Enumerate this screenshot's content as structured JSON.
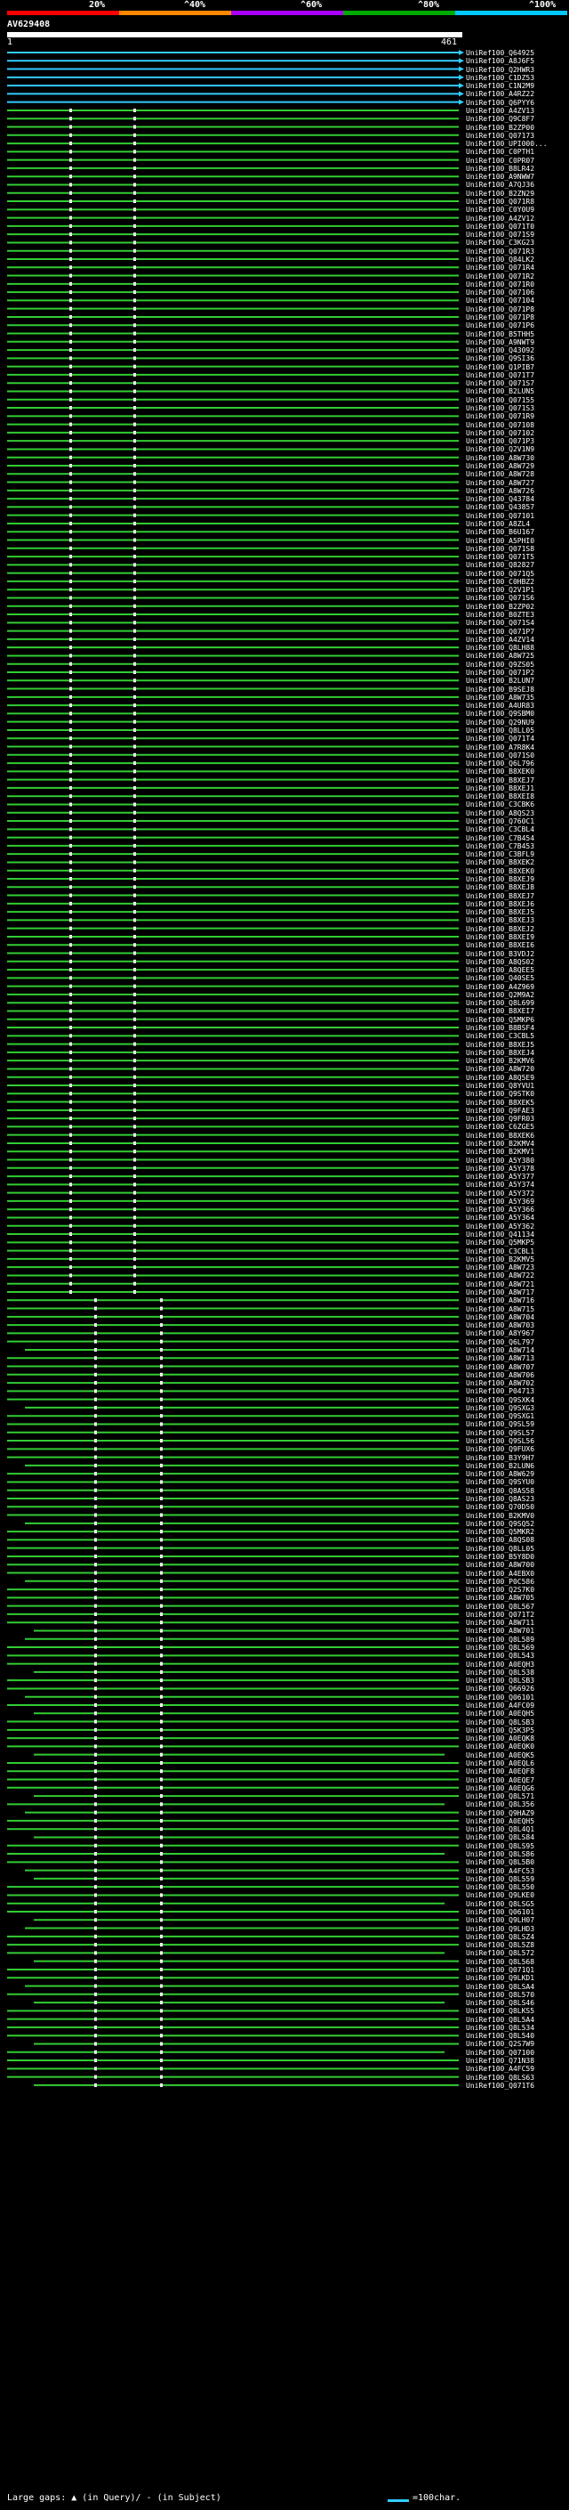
{
  "scale": {
    "ticks": [
      {
        "label": "20%"
      },
      {
        "label": "^40%"
      },
      {
        "label": "^60%"
      },
      {
        "label": "^80%"
      },
      {
        "label": "^100%"
      }
    ],
    "colors": [
      "#ff0000",
      "#ff8800",
      "#aa00ff",
      "#00aa00",
      "#00c8ff"
    ]
  },
  "query": {
    "id": "AV629408",
    "start": "1",
    "end": "461"
  },
  "legend": {
    "gaps": "Large gaps: ▲ (in Query)/ - (in Subject)",
    "scale": "=100char."
  },
  "colors": {
    "cyan_hit": "#33ccff",
    "green_hit": "#33cc33",
    "gap_marker": "#ffffff"
  },
  "hits": [
    "UniRef100_Q64925",
    "UniRef100_A8J6F5",
    "UniRef100_Q2HWR3",
    "UniRef100_C1DZ53",
    "UniRef100_C1N2M9",
    "UniRef100_A4RZ22",
    "UniRef100_Q6PYY6",
    "UniRef100_A4ZV13",
    "UniRef100_Q9C8F7",
    "UniRef100_B2ZP00",
    "UniRef100_Q07173",
    "UniRef100_UPI000...",
    "UniRef100_C0PTH1",
    "UniRef100_C0PR07",
    "UniRef100_B8LR42",
    "UniRef100_A9NWW7",
    "UniRef100_A7QJ36",
    "UniRef100_B2ZN29",
    "UniRef100_Q071R8",
    "UniRef100_C0Y0U9",
    "UniRef100_A4ZV12",
    "UniRef100_Q071T0",
    "UniRef100_Q071S9",
    "UniRef100_C3KG23",
    "UniRef100_Q071R3",
    "UniRef100_Q84LK2",
    "UniRef100_Q071R4",
    "UniRef100_Q071R2",
    "UniRef100_Q071R0",
    "UniRef100_Q07106",
    "UniRef100_Q07104",
    "UniRef100_Q071P8",
    "UniRef100_Q071P8",
    "UniRef100_Q071P6",
    "UniRef100_B5THH5",
    "UniRef100_A9NWT9",
    "UniRef100_Q43092",
    "UniRef100_Q9SI36",
    "UniRef100_Q1PIB7",
    "UniRef100_Q071T7",
    "UniRef100_Q071S7",
    "UniRef100_B2LUN5",
    "UniRef100_Q07155",
    "UniRef100_Q071S3",
    "UniRef100_Q071R9",
    "UniRef100_Q07108",
    "UniRef100_Q07102",
    "UniRef100_Q071P3",
    "UniRef100_Q2V1N9",
    "UniRef100_A8W730",
    "UniRef100_A8W729",
    "UniRef100_A8W728",
    "UniRef100_A8W727",
    "UniRef100_A8W726",
    "UniRef100_Q43784",
    "UniRef100_Q43857",
    "UniRef100_Q07101",
    "UniRef100_A8ZL4",
    "UniRef100_B6U167",
    "UniRef100_A5PHI0",
    "UniRef100_Q071S8",
    "UniRef100_Q071T5",
    "UniRef100_Q82827",
    "UniRef100_Q071Q5",
    "UniRef100_C0HBZ2",
    "UniRef100_Q2V1P1",
    "UniRef100_Q071S6",
    "UniRef100_B2ZP02",
    "UniRef100_B0ZTE3",
    "UniRef100_Q071S4",
    "UniRef100_Q071P7",
    "UniRef100_A4ZV14",
    "UniRef100_Q8LH88",
    "UniRef100_A8W725",
    "UniRef100_Q9ZS05",
    "UniRef100_Q071P2",
    "UniRef100_B2LUN7",
    "UniRef100_B9SEJ8",
    "UniRef100_A8W735",
    "UniRef100_A4UR83",
    "UniRef100_Q9SBM0",
    "UniRef100_Q29NU9",
    "UniRef100_Q8LL05",
    "UniRef100_Q071T4",
    "UniRef100_A7R8K4",
    "UniRef100_Q071S0",
    "UniRef100_Q6L796",
    "UniRef100_B8XEK0",
    "UniRef100_B8XEJ7",
    "UniRef100_B8XEJ1",
    "UniRef100_B8XEI8",
    "UniRef100_C3CBK6",
    "UniRef100_A8QS23",
    "UniRef100_Q760C1",
    "UniRef100_C3CBL4",
    "UniRef100_C7B454",
    "UniRef100_C7B453",
    "UniRef100_C3BFL9",
    "UniRef100_B8XEK2",
    "UniRef100_B8XEK0",
    "UniRef100_B8XEJ9",
    "UniRef100_B8XEJ8",
    "UniRef100_B8XEJ7",
    "UniRef100_B8XEJ6",
    "UniRef100_B8XEJ5",
    "UniRef100_B8XEJ3",
    "UniRef100_B8XEJ2",
    "UniRef100_B8XEI9",
    "UniRef100_B8XEI6",
    "UniRef100_B3VDJ2",
    "UniRef100_A8QS02",
    "UniRef100_A8QEE5",
    "UniRef100_Q40SE5",
    "UniRef100_A4Z969",
    "UniRef100_Q2M9A2",
    "UniRef100_Q8L699",
    "UniRef100_B8XEI7",
    "UniRef100_Q5MKP6",
    "UniRef100_B8BSF4",
    "UniRef100_C3CBL5",
    "UniRef100_B8XEJ5",
    "UniRef100_B8XEJ4",
    "UniRef100_B2KMV6",
    "UniRef100_A8W720",
    "UniRef100_A8Q5E9",
    "UniRef100_Q8YVU1",
    "UniRef100_Q9STK0",
    "UniRef100_B8XEK5",
    "UniRef100_Q9FAE3",
    "UniRef100_Q9FR03",
    "UniRef100_C6ZGE5",
    "UniRef100_B8XEK6",
    "UniRef100_B2KMV4",
    "UniRef100_B2KMV1",
    "UniRef100_A5Y380",
    "UniRef100_A5Y378",
    "UniRef100_A5Y377",
    "UniRef100_A5Y374",
    "UniRef100_A5Y372",
    "UniRef100_A5Y369",
    "UniRef100_A5Y366",
    "UniRef100_A5Y364",
    "UniRef100_A5Y362",
    "UniRef100_Q41134",
    "UniRef100_Q5MKP5",
    "UniRef100_C3CBL1",
    "UniRef100_B2KMV5",
    "UniRef100_A8W723",
    "UniRef100_A8W722",
    "UniRef100_A8W721",
    "UniRef100_A8W717",
    "UniRef100_A8W716",
    "UniRef100_A8W715",
    "UniRef100_A8W704",
    "UniRef100_A8W703",
    "UniRef100_A8Y967",
    "UniRef100_Q6L797",
    "UniRef100_A8W714",
    "UniRef100_A8W713",
    "UniRef100_A8W707",
    "UniRef100_A8W706",
    "UniRef100_A8W702",
    "UniRef100_P04713",
    "UniRef100_Q9SXK4",
    "UniRef100_Q9SXG3",
    "UniRef100_Q9SXG1",
    "UniRef100_Q9SL59",
    "UniRef100_Q9SL57",
    "UniRef100_Q9SL56",
    "UniRef100_Q9FUX6",
    "UniRef100_B3Y9H7",
    "UniRef100_B2LUN6",
    "UniRef100_A8W629",
    "UniRef100_Q9SYU0",
    "UniRef100_Q8AS58",
    "UniRef100_Q8AS23",
    "UniRef100_Q70D50",
    "UniRef100_B2KMV0",
    "UniRef100_Q9SQ52",
    "UniRef100_Q5MKR2",
    "UniRef100_A8QS08",
    "UniRef100_Q8LL05",
    "UniRef100_B5Y8D0",
    "UniRef100_A8W700",
    "UniRef100_A4EBX0",
    "UniRef100_P0C586",
    "UniRef100_Q2S7K0",
    "UniRef100_A8W705",
    "UniRef100_Q8L567",
    "UniRef100_Q071T2",
    "UniRef100_A8W711",
    "UniRef100_A8W701",
    "UniRef100_Q8L589",
    "UniRef100_Q8L569",
    "UniRef100_Q8L543",
    "UniRef100_A0EQH3",
    "UniRef100_Q8L538",
    "UniRef100_Q8LSB3",
    "UniRef100_Q66926",
    "UniRef100_Q06101",
    "UniRef100_A4FC09",
    "UniRef100_A0EQH5",
    "UniRef100_Q8LSB3",
    "UniRef100_Q5K3P5",
    "UniRef100_A0EQK8",
    "UniRef100_A0EQK0",
    "UniRef100_A0EQK5",
    "UniRef100_A0EQL6",
    "UniRef100_A0EQF8",
    "UniRef100_A0EQE7",
    "UniRef100_A0EQG6",
    "UniRef100_Q8L571",
    "UniRef100_Q8L356",
    "UniRef100_Q9HAZ9",
    "UniRef100_A0EQH5",
    "UniRef100_Q8L4Q1",
    "UniRef100_Q8LS84",
    "UniRef100_Q8LS95",
    "UniRef100_Q8LS86",
    "UniRef100_Q8L5B0",
    "UniRef100_A4FC53",
    "UniRef100_Q8L559",
    "UniRef100_Q8L550",
    "UniRef100_Q9LKE0",
    "UniRef100_Q8LSG5",
    "UniRef100_Q06101",
    "UniRef100_Q9LH07",
    "UniRef100_Q9LHD3",
    "UniRef100_Q8LSZ4",
    "UniRef100_Q8L5Z8",
    "UniRef100_Q8L572",
    "UniRef100_Q8L568",
    "UniRef100_Q071Q1",
    "UniRef100_Q9LKD1",
    "UniRef100_Q8LSA4",
    "UniRef100_Q8L570",
    "UniRef100_Q8LS46",
    "UniRef100_Q8LKS5",
    "UniRef100_Q8L5A4",
    "UniRef100_Q8L534",
    "UniRef100_Q8L540",
    "UniRef100_Q2S7W9",
    "UniRef100_Q07100",
    "UniRef100_Q71N38",
    "UniRef100_A4FC59",
    "UniRef100_Q8LS63",
    "UniRef100_Q071T6"
  ]
}
